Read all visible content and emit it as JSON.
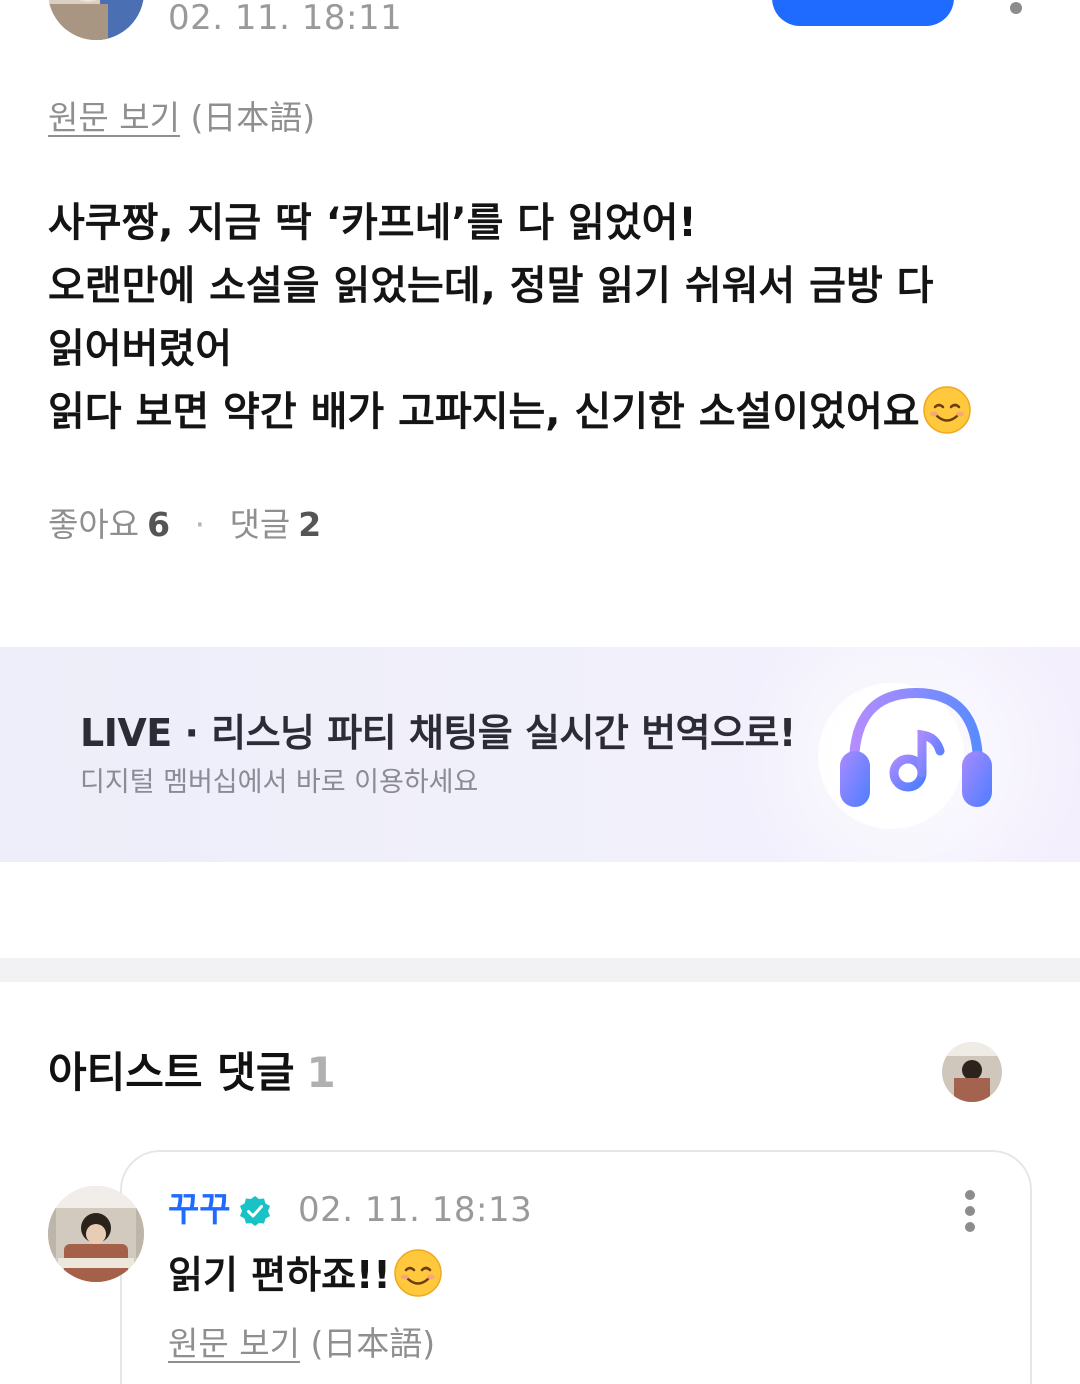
{
  "post": {
    "timestamp": "02. 11. 18:11",
    "translate_link": "원문 보기",
    "translate_lang": "(日本語)",
    "body": "사쿠짱, 지금 딱 ‘카프네’를 다 읽었어!\n오랜만에 소설을 읽었는데, 정말 읽기 쉬워서 금방 다\n읽어버렸어\n읽다 보면 약간 배가 고파지는, 신기한 소설이었어요",
    "body_emoji_icon": "smiling-face-emoji",
    "likes_label": "좋아요",
    "likes_count": "6",
    "comments_label": "댓글",
    "comments_count": "2",
    "dot": "·"
  },
  "banner": {
    "title": "LIVE · 리스닝 파티 채팅을 실시간 번역으로!",
    "subtitle": "디지털 멤버십에서 바로 이용하세요",
    "icon": "headphones-music-icon"
  },
  "artist_comments": {
    "title": "아티스트 댓글",
    "count": "1",
    "comment": {
      "author": "꾸꾸",
      "timestamp": "02. 11. 18:13",
      "body": "읽기 편하죠!!",
      "emoji_icon": "smiling-face-emoji",
      "translate_link": "원문 보기",
      "translate_lang": "(日本語)"
    }
  },
  "colors": {
    "accent": "#1f6bff",
    "muted_text": "#8f8f8f"
  }
}
